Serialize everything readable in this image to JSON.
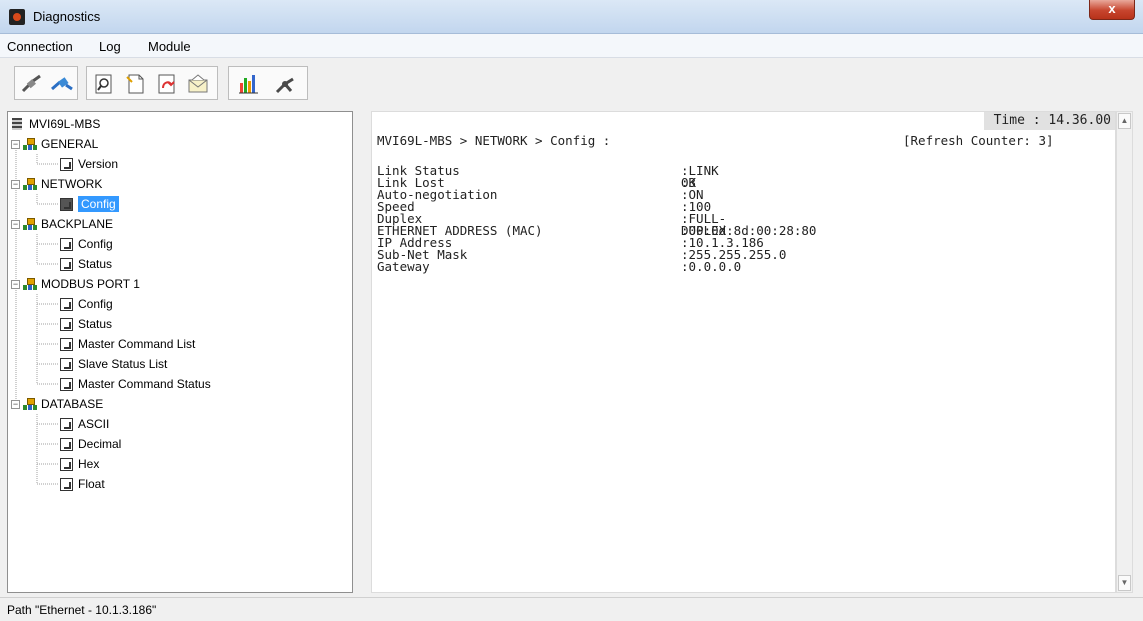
{
  "window": {
    "title": "Diagnostics",
    "close_label": "x"
  },
  "menu": {
    "items": [
      "Connection",
      "Log",
      "Module"
    ]
  },
  "toolbar": {
    "icons": [
      "disconnect-icon",
      "connect-icon",
      "find-icon",
      "new-page-icon",
      "open-icon",
      "mail-icon",
      "bar-chart-icon",
      "settings-icon"
    ]
  },
  "tree": {
    "root": "MVI69L-MBS",
    "general": {
      "label": "GENERAL",
      "children": [
        "Version"
      ]
    },
    "network": {
      "label": "NETWORK",
      "children": [
        "Config"
      ]
    },
    "backplane": {
      "label": "BACKPLANE",
      "children": [
        "Config",
        "Status"
      ]
    },
    "modbus": {
      "label": "MODBUS PORT 1",
      "children": [
        "Config",
        "Status",
        "Master Command List",
        "Slave Status List",
        "Master Command Status"
      ]
    },
    "database": {
      "label": "DATABASE",
      "children": [
        "ASCII",
        "Decimal",
        "Hex",
        "Float"
      ]
    },
    "expander_symbol": "−"
  },
  "content": {
    "time": "Time : 14.36.00",
    "breadcrumb": "MVI69L-MBS > NETWORK > Config :",
    "refresh_counter": "[Refresh Counter: 3]",
    "rows": [
      {
        "key": "Link Status",
        "value": ":LINK OK"
      },
      {
        "key": "Link Lost",
        "value": ":3"
      },
      {
        "key": "Auto-negotiation",
        "value": ":ON"
      },
      {
        "key": "Speed",
        "value": ":100"
      },
      {
        "key": "Duplex",
        "value": ":FULL-DUPLEX"
      },
      {
        "key": "ETHERNET ADDRESS (MAC)",
        "value": ":00:0d:8d:00:28:80"
      },
      {
        "key": "IP Address",
        "value": ":10.1.3.186"
      },
      {
        "key": "Sub-Net Mask",
        "value": ":255.255.255.0"
      },
      {
        "key": "Gateway",
        "value": ":0.0.0.0"
      }
    ]
  },
  "scrollbar": {
    "up": "▲",
    "down": "▼"
  },
  "status": {
    "path": "Path \"Ethernet - 10.1.3.186\""
  },
  "colors": {
    "selection": "#3399ff",
    "close_button": "#c7452e",
    "titlebar": "#c2d6ee"
  }
}
